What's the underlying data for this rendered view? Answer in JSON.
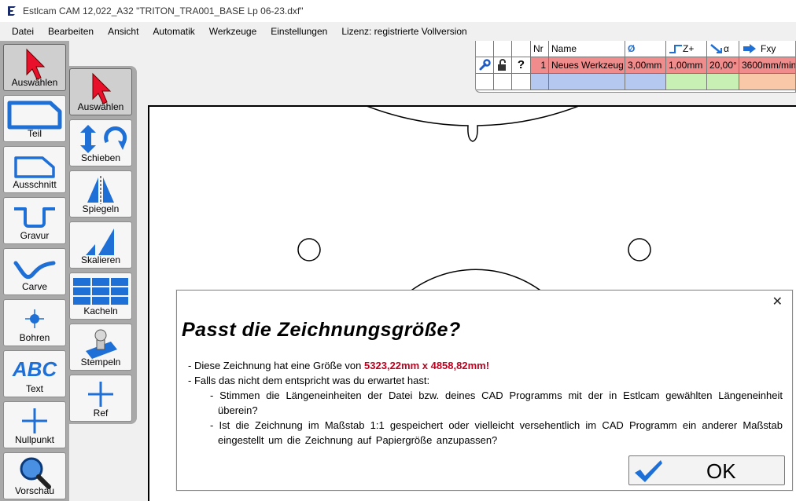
{
  "window": {
    "title": "Estlcam CAM 12,022_A32 \"TRITON_TRA001_BASE Lp 06-23.dxf\""
  },
  "menu": [
    "Datei",
    "Bearbeiten",
    "Ansicht",
    "Automatik",
    "Werkzeuge",
    "Einstellungen",
    "Lizenz: registrierte Vollversion"
  ],
  "left_tools": [
    {
      "label": "Auswählen",
      "icon": "red-arrow-cursor-icon"
    },
    {
      "label": "Teil",
      "icon": "part-outline-icon"
    },
    {
      "label": "Ausschnitt",
      "icon": "cutout-outline-icon"
    },
    {
      "label": "Gravur",
      "icon": "engrave-groove-icon"
    },
    {
      "label": "Carve",
      "icon": "carve-wave-icon"
    },
    {
      "label": "Bohren",
      "icon": "drill-crosshair-icon"
    },
    {
      "label": "Text",
      "icon": "abc-text-icon"
    },
    {
      "label": "Nullpunkt",
      "icon": "origin-plus-icon"
    },
    {
      "label": "Vorschau",
      "icon": "magnifier-icon"
    }
  ],
  "mid_tools": [
    {
      "label": "Auswählen",
      "icon": "red-arrow-cursor-icon"
    },
    {
      "label": "Schieben",
      "icon": "move-rotate-icon"
    },
    {
      "label": "Spiegeln",
      "icon": "mirror-icon"
    },
    {
      "label": "Skalieren",
      "icon": "scale-icon"
    },
    {
      "label": "Kacheln",
      "icon": "tiles-grid-icon"
    },
    {
      "label": "Stempeln",
      "icon": "stamp-icon"
    },
    {
      "label": "Ref",
      "icon": "reference-plus-icon"
    }
  ],
  "tool_table": {
    "headers": [
      "Nr",
      "Name",
      "Ø",
      "Z+",
      "α",
      "Fxy"
    ],
    "row": {
      "nr": "1",
      "name": "Neues Werkzeug",
      "diameter": "3,00mm",
      "zplus": "1,00mm",
      "alpha": "20,00°",
      "fxy": "3600mm/min"
    }
  },
  "dialog": {
    "title": "Passt  die  Zeichnungsgröße?",
    "line1_prefix": "- Diese Zeichnung hat eine Größe von",
    "line1_size": "5323,22mm  x  4858,82mm!",
    "line2": "- Falls das nicht dem entspricht was du erwartet hast:",
    "bullet1": "- Stimmen die Längeneinheiten der Datei bzw. deines CAD Programms mit der in Estlcam gewählten Längeneinheit überein?",
    "bullet2": "- Ist die Zeichnung im Maßstab 1:1 gespeichert oder vielleicht versehentlich im CAD Programm ein anderer Maßstab eingestellt um die Zeichnung auf Papiergröße anzupassen?",
    "ok_label": "OK",
    "close_glyph": "✕"
  },
  "colors": {
    "accent_blue": "#1e6fd6",
    "highlight_red": "#c0001f",
    "row_red": "#f08c8c",
    "cell_blue": "#b4c8f0",
    "cell_green": "#c8f0b4",
    "cell_orange": "#f8c8a8"
  }
}
